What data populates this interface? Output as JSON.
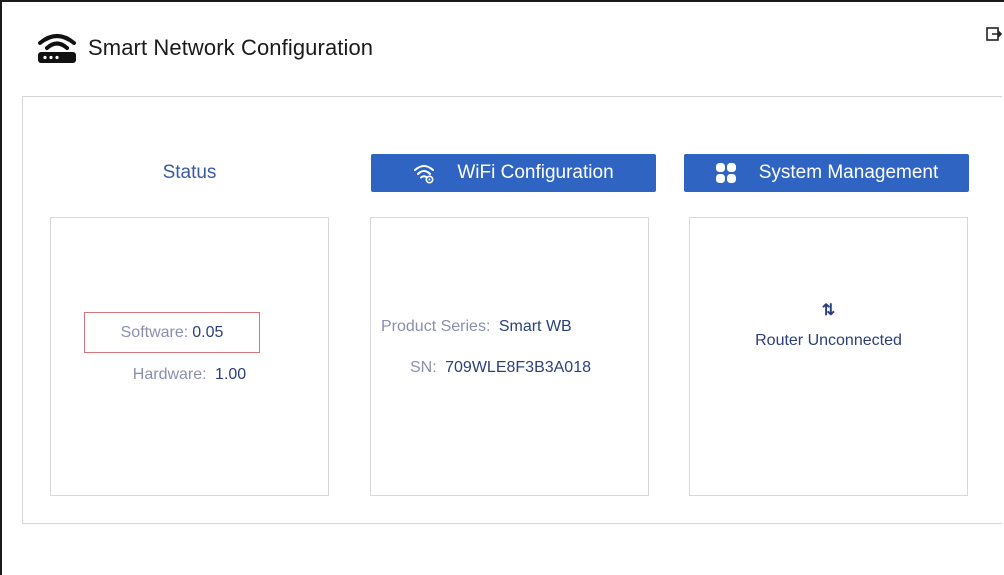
{
  "header": {
    "title": "Smart Network Configuration",
    "logo_icon": "router-icon",
    "logout_icon": "logout-icon"
  },
  "status": {
    "heading": "Status",
    "software_label": "Software: ",
    "software_value": "0.05",
    "hardware_label": "Hardware: ",
    "hardware_value": "1.00"
  },
  "wifi": {
    "button_label": "WiFi Configuration",
    "button_icon": "wifi-settings-icon",
    "product_series_label": "Product Series: ",
    "product_series_value": "Smart WB",
    "sn_label": "SN: ",
    "sn_value": "709WLE8F3B3A018"
  },
  "system": {
    "button_label": "System Management",
    "button_icon": "grid-apps-icon",
    "router_status_icon": "up-down-arrows-icon",
    "router_status_glyph": "⇅",
    "router_status_text": "Router Unconnected"
  },
  "colors": {
    "accent": "#2f64c2",
    "label": "#8a8fb0",
    "value": "#2c3f7a",
    "highlight_border": "#d9757a"
  }
}
